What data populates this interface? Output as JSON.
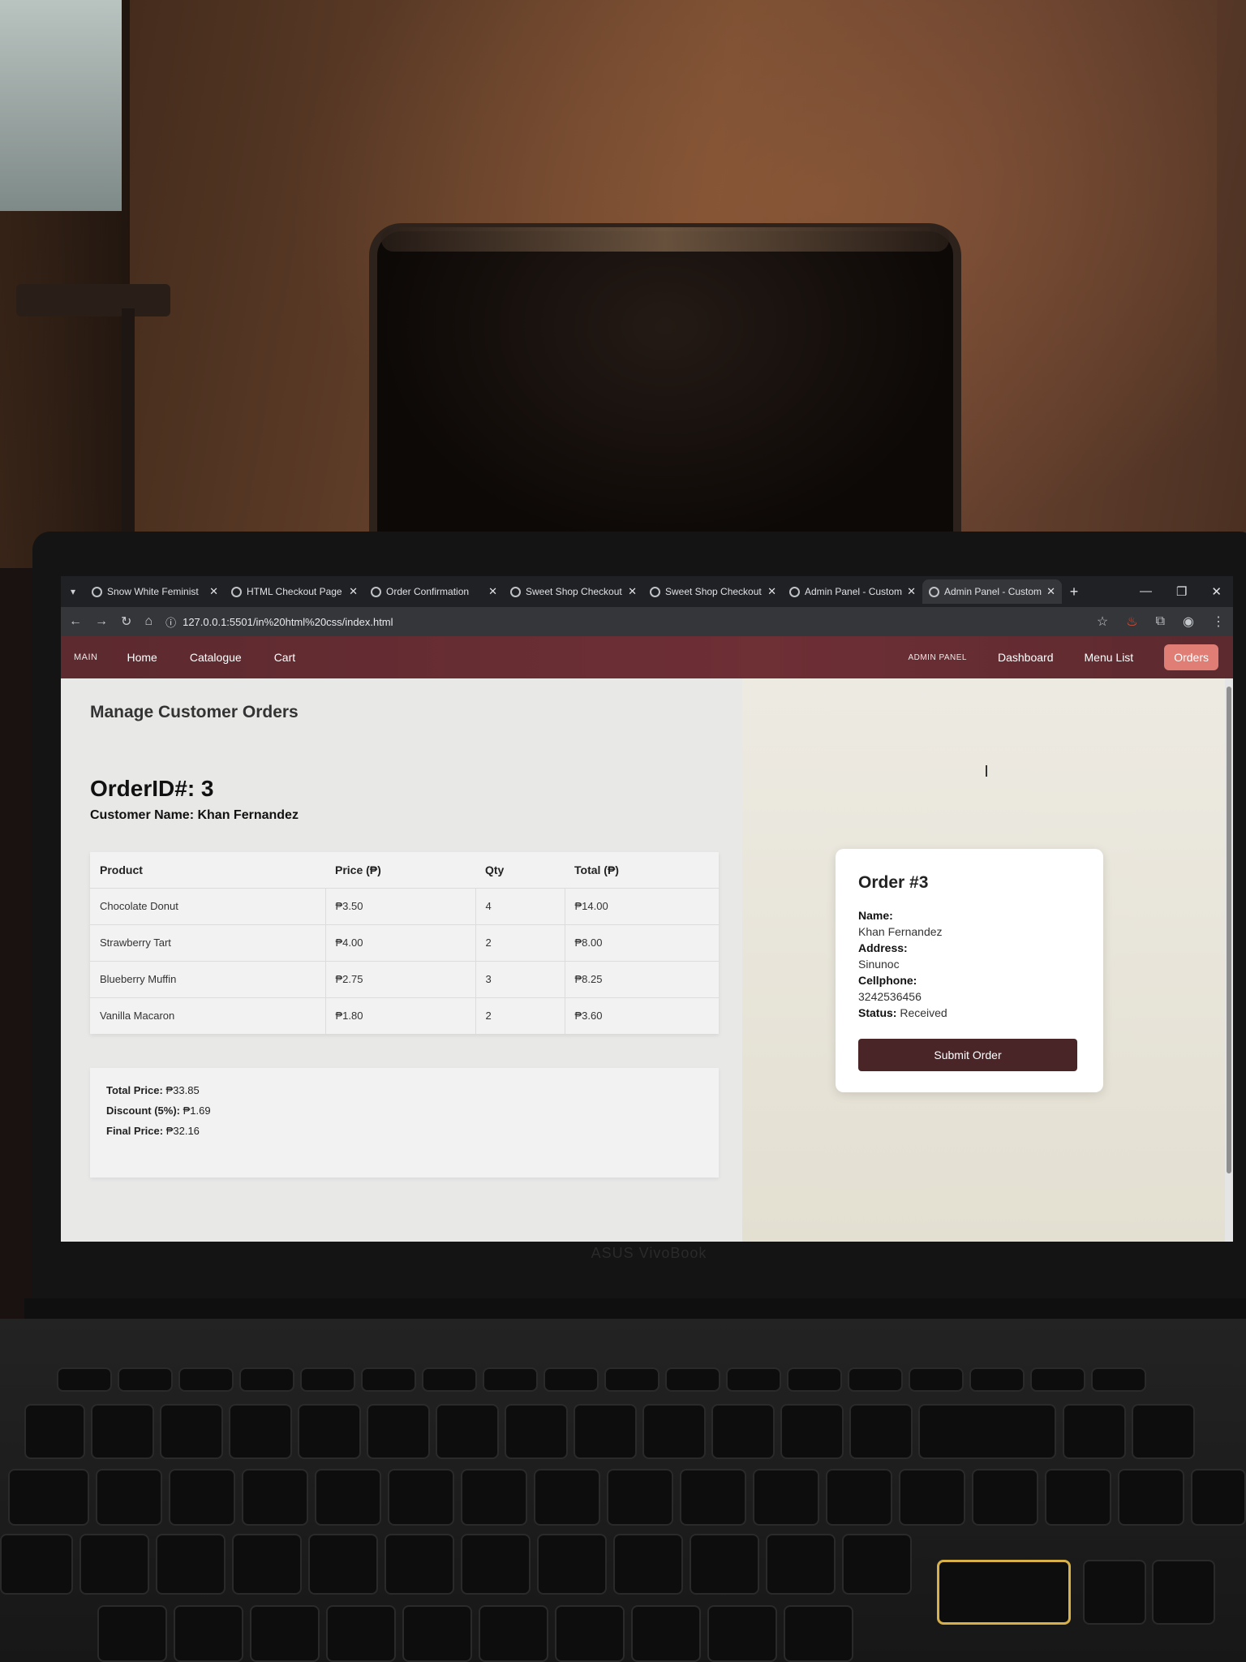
{
  "browser": {
    "tabs": [
      {
        "title": "Snow White Feminist",
        "active": false
      },
      {
        "title": "HTML Checkout Page",
        "active": false
      },
      {
        "title": "Order Confirmation",
        "active": false
      },
      {
        "title": "Sweet Shop Checkout",
        "active": false
      },
      {
        "title": "Sweet Shop Checkout",
        "active": false
      },
      {
        "title": "Admin Panel - Custom",
        "active": false
      },
      {
        "title": "Admin Panel - Custom",
        "active": true
      }
    ],
    "url": "127.0.0.1:5501/in%20html%20css/index.html"
  },
  "nav": {
    "main_label": "MAIN",
    "links": [
      "Home",
      "Catalogue",
      "Cart"
    ],
    "admin_label": "ADMIN PANEL",
    "admin_links": [
      "Dashboard",
      "Menu List",
      "Orders"
    ],
    "active_link": "Orders"
  },
  "page": {
    "title": "Manage Customer Orders",
    "order_id": "OrderID#: 3",
    "customer_name": "Customer Name: Khan Fernandez"
  },
  "table": {
    "headers": [
      "Product",
      "Price (₱)",
      "Qty",
      "Total (₱)"
    ],
    "rows": [
      [
        "Chocolate Donut",
        "₱3.50",
        "4",
        "₱14.00"
      ],
      [
        "Strawberry Tart",
        "₱4.00",
        "2",
        "₱8.00"
      ],
      [
        "Blueberry Muffin",
        "₱2.75",
        "3",
        "₱8.25"
      ],
      [
        "Vanilla Macaron",
        "₱1.80",
        "2",
        "₱3.60"
      ]
    ]
  },
  "summary": {
    "total_label": "Total Price:",
    "total_value": "₱33.85",
    "discount_label": "Discount (5%):",
    "discount_value": "₱1.69",
    "final_label": "Final Price:",
    "final_value": "₱32.16"
  },
  "card": {
    "title": "Order #3",
    "name_label": "Name:",
    "name_value": "Khan Fernandez",
    "address_label": "Address:",
    "address_value": "Sinunoc",
    "phone_label": "Cellphone:",
    "phone_value": "3242536456",
    "status_label": "Status:",
    "status_value": "Received",
    "submit_label": "Submit Order"
  },
  "laptop": {
    "brand": "ASUS VivoBook"
  },
  "colors": {
    "nav": "#6e2f35",
    "orders_button": "#e07e75",
    "submit_button": "#4a2528",
    "enter_key_outline": "#d8b04a"
  }
}
